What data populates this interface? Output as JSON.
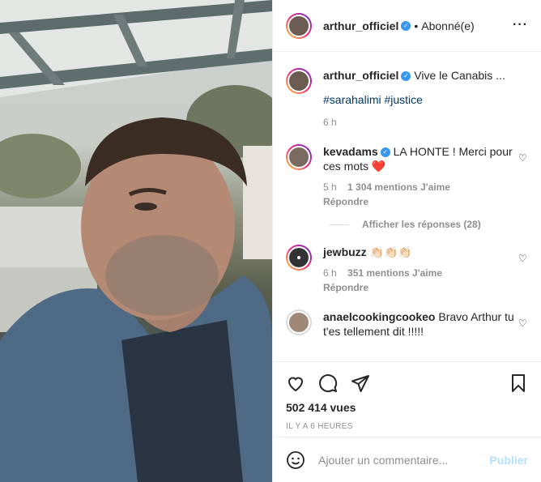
{
  "header": {
    "username": "arthur_officiel",
    "follow_status": "Abonné(e)",
    "more_icon": "more-icon"
  },
  "caption": {
    "username": "arthur_officiel",
    "text": "Vive le Canabis ...",
    "hashtags": "#sarahalimi #justice",
    "time": "6 h"
  },
  "comments": [
    {
      "username": "kevadams",
      "text": "LA HONTE ! Merci pour ces mots ❤️",
      "time": "5 h",
      "likes": "1 304 mentions J'aime",
      "reply": "Répondre"
    },
    {
      "username": "jewbuzz",
      "text": "👏🏻👏🏻👏🏻",
      "time": "6 h",
      "likes": "351 mentions J'aime",
      "reply": "Répondre"
    },
    {
      "username": "anaelcookingcookeo",
      "text": "Bravo Arthur tu t'es tellement dit !!!!!"
    }
  ],
  "view_replies": "Afficher les réponses (28)",
  "stats": {
    "views": "502 414 vues",
    "posted_ago": "IL Y A 6 HEURES"
  },
  "add_comment": {
    "placeholder": "Ajouter un commentaire...",
    "publish": "Publier"
  },
  "colors": {
    "verified": "#3897f0",
    "link": "#00376b",
    "publish": "#b2dffc",
    "heart": "#ed4956"
  }
}
